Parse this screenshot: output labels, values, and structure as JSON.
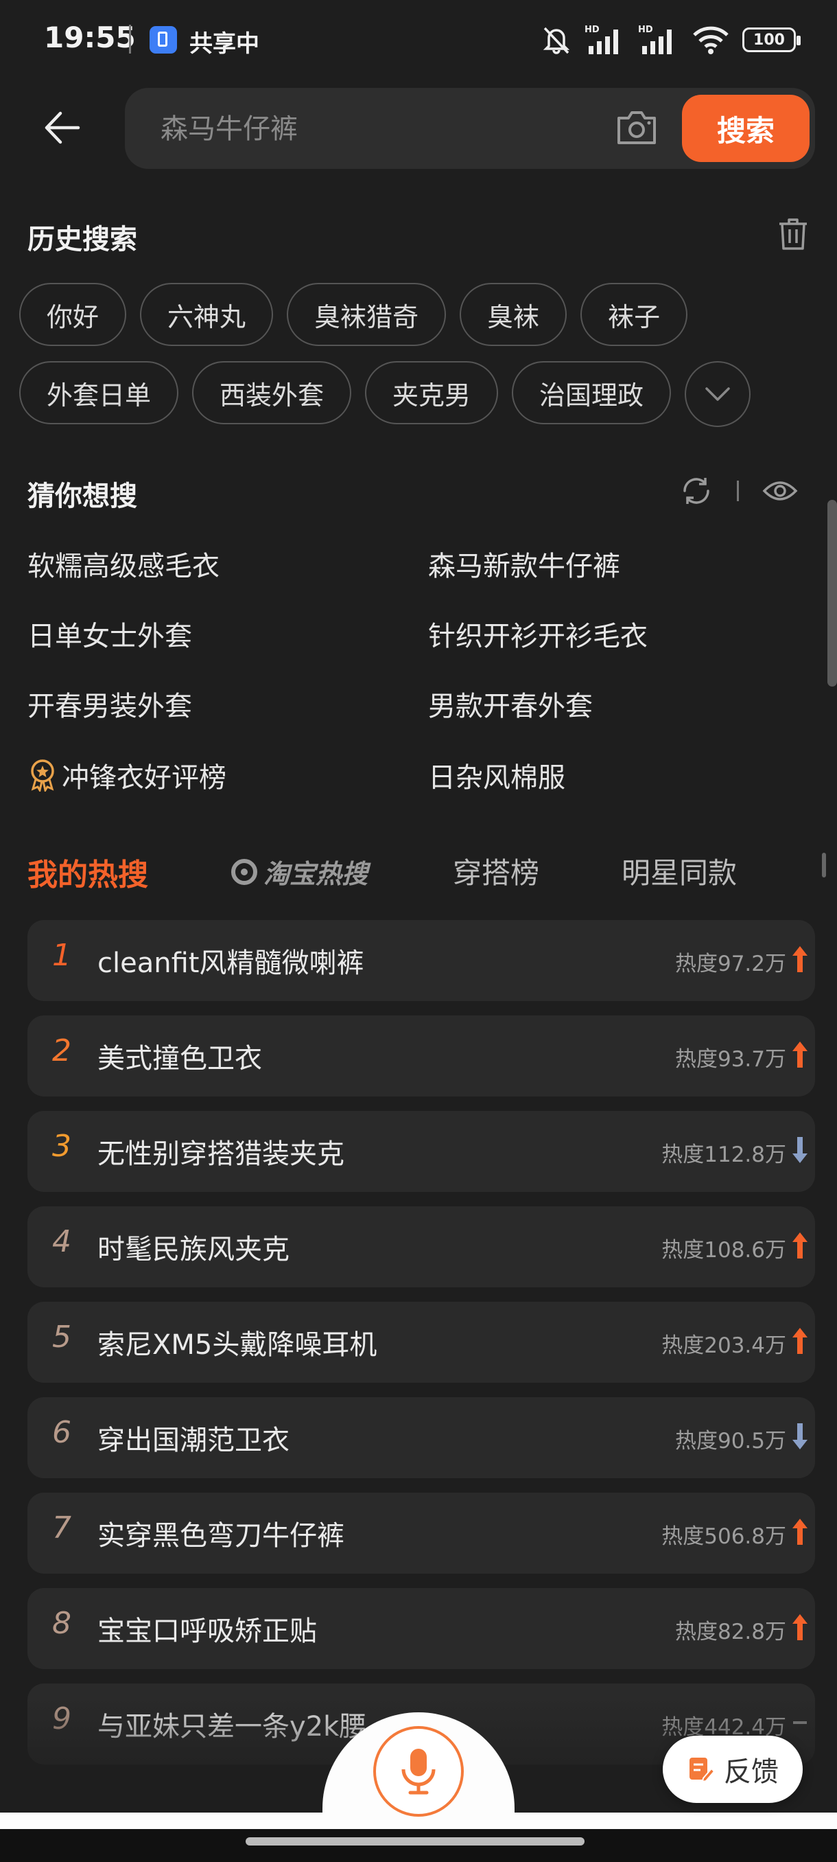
{
  "status_bar": {
    "time": "19:55",
    "share_label": "共享中",
    "battery": "100",
    "icons": [
      "bell-off-icon",
      "hd-signal-icon",
      "hd-signal-icon",
      "wifi-icon",
      "battery-icon"
    ]
  },
  "search": {
    "placeholder": "森马牛仔裤",
    "button_label": "搜索"
  },
  "history": {
    "title": "历史搜索",
    "chips": [
      "你好",
      "六神丸",
      "臭袜猎奇",
      "臭袜",
      "袜子",
      "外套日单",
      "西装外套",
      "夹克男",
      "治国理政"
    ]
  },
  "guess": {
    "title": "猜你想搜",
    "items": [
      "软糯高级感毛衣",
      "森马新款牛仔裤",
      "日单女士外套",
      "针织开衫开衫毛衣",
      "开春男装外套",
      "男款开春外套",
      "冲锋衣好评榜",
      "日杂风棉服"
    ]
  },
  "tabs": {
    "items": [
      "我的热搜",
      "淘宝热搜",
      "穿搭榜",
      "明星同款"
    ],
    "active": 0
  },
  "hot_list": [
    {
      "rank": "1",
      "title": "cleanfit风精髓微喇裤",
      "heat": "热度97.2万",
      "trend": "up"
    },
    {
      "rank": "2",
      "title": "美式撞色卫衣",
      "heat": "热度93.7万",
      "trend": "up"
    },
    {
      "rank": "3",
      "title": "无性别穿搭猎装夹克",
      "heat": "热度112.8万",
      "trend": "down"
    },
    {
      "rank": "4",
      "title": "时髦民族风夹克",
      "heat": "热度108.6万",
      "trend": "up"
    },
    {
      "rank": "5",
      "title": "索尼XM5头戴降噪耳机",
      "heat": "热度203.4万",
      "trend": "up"
    },
    {
      "rank": "6",
      "title": "穿出国潮范卫衣",
      "heat": "热度90.5万",
      "trend": "down"
    },
    {
      "rank": "7",
      "title": "实穿黑色弯刀牛仔裤",
      "heat": "热度506.8万",
      "trend": "up"
    },
    {
      "rank": "8",
      "title": "宝宝口呼吸矫正贴",
      "heat": "热度82.8万",
      "trend": "up"
    },
    {
      "rank": "9",
      "title": "与亚妹只差一条y2k腰",
      "heat": "热度442.4万",
      "trend": "flat"
    }
  ],
  "feedback_label": "反馈",
  "colors": {
    "accent": "#f4622a",
    "background": "#1e1e1e",
    "row": "#2a2a2a",
    "trend_up": "#f4622a",
    "trend_down": "#8aa0c8"
  }
}
